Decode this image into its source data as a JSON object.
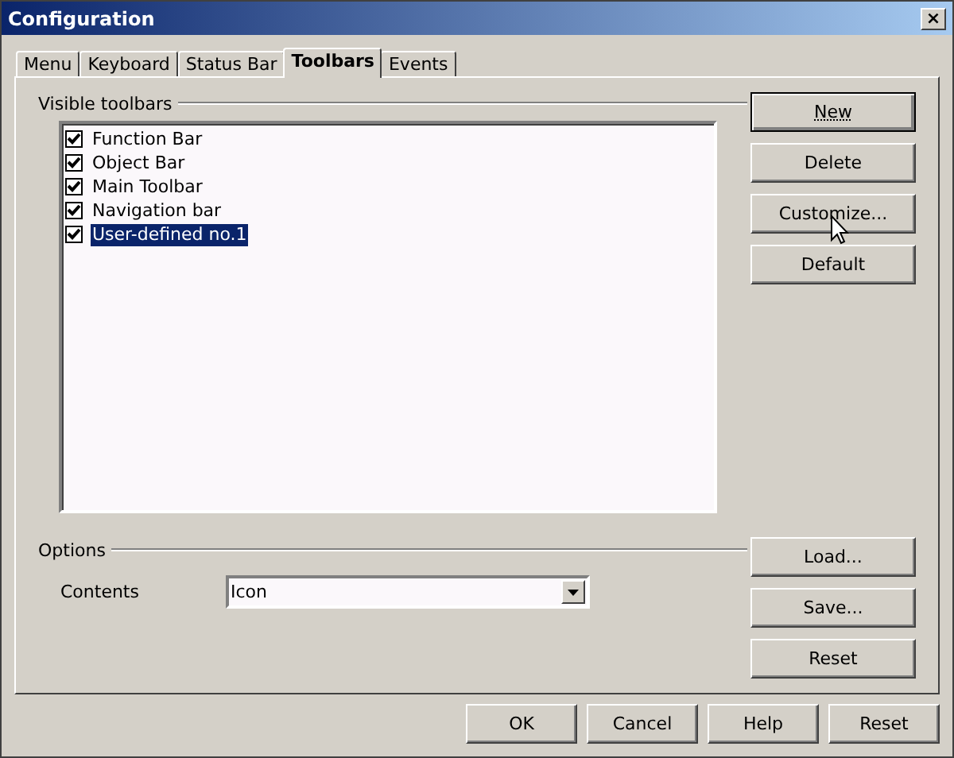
{
  "window": {
    "title": "Configuration",
    "close": "×"
  },
  "tabs": [
    {
      "label": "Menu",
      "selected": false
    },
    {
      "label": "Keyboard",
      "selected": false
    },
    {
      "label": "Status Bar",
      "selected": false
    },
    {
      "label": "Toolbars",
      "selected": true
    },
    {
      "label": "Events",
      "selected": false
    }
  ],
  "visible_toolbars": {
    "heading": "Visible toolbars",
    "items": [
      {
        "label": "Function Bar",
        "checked": true,
        "selected": false
      },
      {
        "label": "Object Bar",
        "checked": true,
        "selected": false
      },
      {
        "label": "Main Toolbar",
        "checked": true,
        "selected": false
      },
      {
        "label": "Navigation bar",
        "checked": true,
        "selected": false
      },
      {
        "label": "User-defined no.1",
        "checked": true,
        "selected": true
      }
    ]
  },
  "side_buttons": [
    {
      "label": "New",
      "focused": true
    },
    {
      "label": "Delete",
      "focused": false
    },
    {
      "label": "Customize...",
      "focused": false
    },
    {
      "label": "Default",
      "focused": false
    }
  ],
  "options": {
    "heading": "Options",
    "contents_label": "Contents",
    "contents_value": "Icon"
  },
  "file_buttons": [
    "Load...",
    "Save...",
    "Reset"
  ],
  "dialog_buttons": [
    "OK",
    "Cancel",
    "Help",
    "Reset"
  ]
}
